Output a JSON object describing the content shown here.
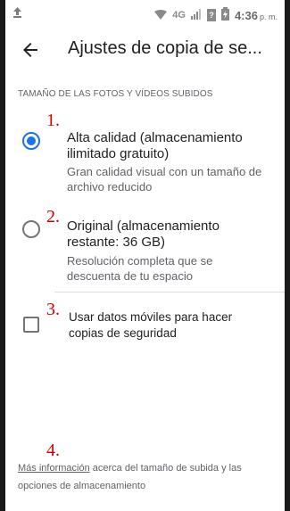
{
  "status_bar": {
    "network": "4G",
    "time": "4:36",
    "ampm": "p. m."
  },
  "app_bar": {
    "title": "Ajustes de copia de se..."
  },
  "section_header": "TAMAÑO DE LAS FOTOS Y VÍDEOS SUBIDOS",
  "annotations": [
    "1.",
    "2.",
    "3.",
    "4."
  ],
  "options": [
    {
      "title": "Alta calidad (almacenamiento ilimitado gratuito)",
      "subtitle": "Gran calidad visual con un tamaño de archivo reducido",
      "selected": true
    },
    {
      "title": "Original (almacenamiento restante: 36 GB)",
      "subtitle": "Resolución completa que se descuenta de tu espacio",
      "selected": false
    }
  ],
  "mobile_data": {
    "label": "Usar datos móviles para hacer copias de seguridad",
    "checked": false
  },
  "footer": {
    "link": "Más información",
    "text": " acerca del tamaño de subida y las opciones de almacenamiento"
  },
  "colors": {
    "accent": "#1a73e8",
    "annotation": "#d40000"
  }
}
